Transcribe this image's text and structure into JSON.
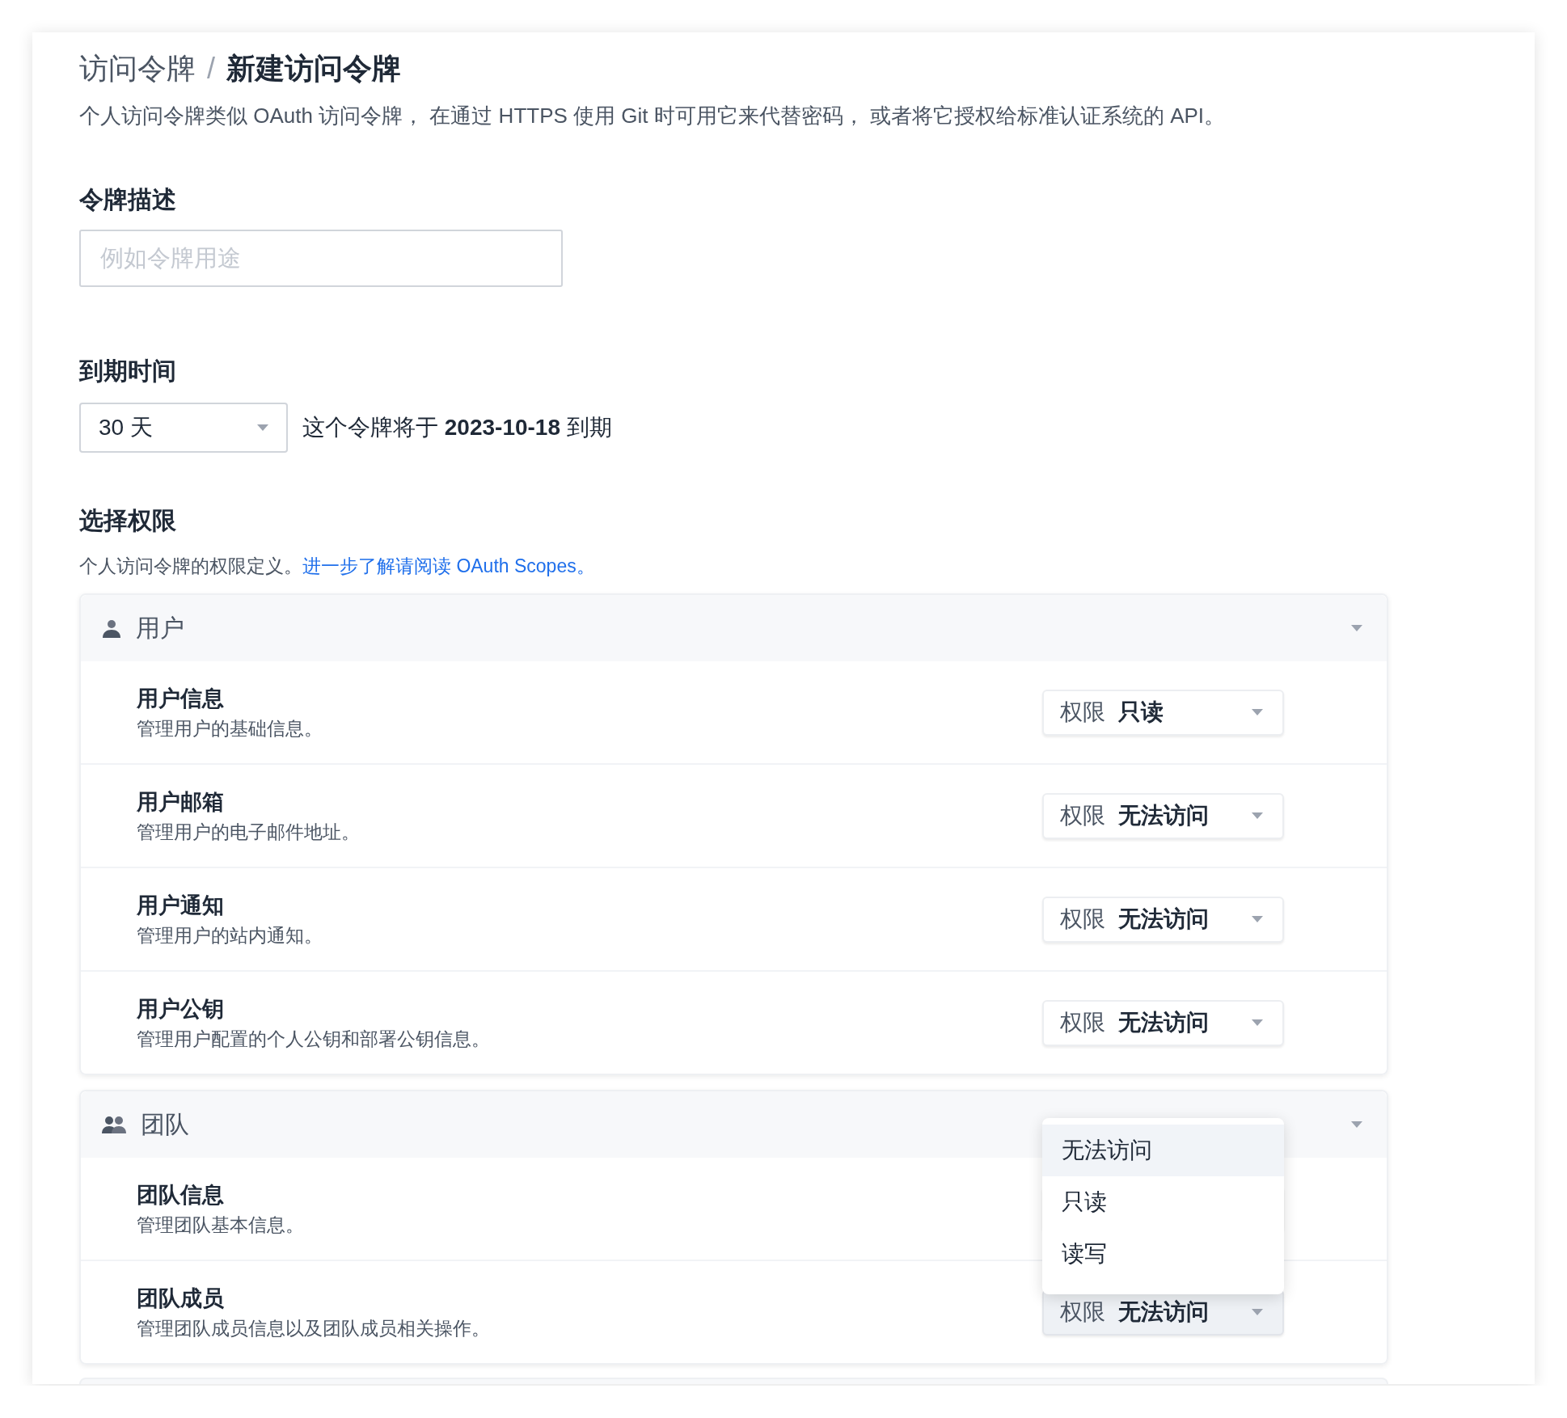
{
  "breadcrumb": {
    "items": [
      {
        "label": "访问令牌",
        "current": false
      },
      {
        "label": "新建访问令牌",
        "current": true
      }
    ],
    "separator": "/"
  },
  "intro": "个人访问令牌类似 OAuth 访问令牌， 在通过 HTTPS 使用 Git 时可用它来代替密码， 或者将它授权给标准认证系统的 API。",
  "description_field": {
    "label": "令牌描述",
    "placeholder": "例如令牌用途"
  },
  "expiration": {
    "label": "到期时间",
    "value": "30 天",
    "note": "这个令牌将于 **2023-10-18** 到期"
  },
  "scopes": {
    "title": "选择权限",
    "hint": "个人访问令牌的权限定义。",
    "link": "进一步了解请阅读 OAuth Scopes。"
  },
  "groups": [
    {
      "title": "用户",
      "rows": [
        {
          "title": "用户信息",
          "description": "管理用户的基础信息。",
          "permission": {
            "label": "权限",
            "value": "只读",
            "highlighted": false,
            "open": false
          }
        },
        {
          "title": "用户邮箱",
          "description": "管理用户的电子邮件地址。",
          "permission": {
            "label": "权限",
            "value": "无法访问",
            "highlighted": false,
            "open": false
          }
        },
        {
          "title": "用户通知",
          "description": "管理用户的站内通知。",
          "permission": {
            "label": "权限",
            "value": "无法访问",
            "highlighted": false,
            "open": false
          }
        },
        {
          "title": "用户公钥",
          "description": "管理用户配置的个人公钥和部署公钥信息。",
          "permission": {
            "label": "权限",
            "value": "无法访问",
            "highlighted": false,
            "open": false
          }
        }
      ]
    },
    {
      "title": "团队",
      "rows": [
        {
          "title": "团队信息",
          "description": "管理团队基本信息。",
          "permission": {
            "highlighted": false,
            "open": true,
            "options": [
              {
                "label": "无法访问",
                "selected": true
              },
              {
                "label": "只读",
                "selected": false
              },
              {
                "label": "读写",
                "selected": false
              }
            ]
          }
        },
        {
          "title": "团队成员",
          "description": "管理团队成员信息以及团队成员相关操作。",
          "permission": {
            "label": "权限",
            "value": "无法访问",
            "highlighted": true,
            "open": false
          }
        }
      ]
    }
  ]
}
